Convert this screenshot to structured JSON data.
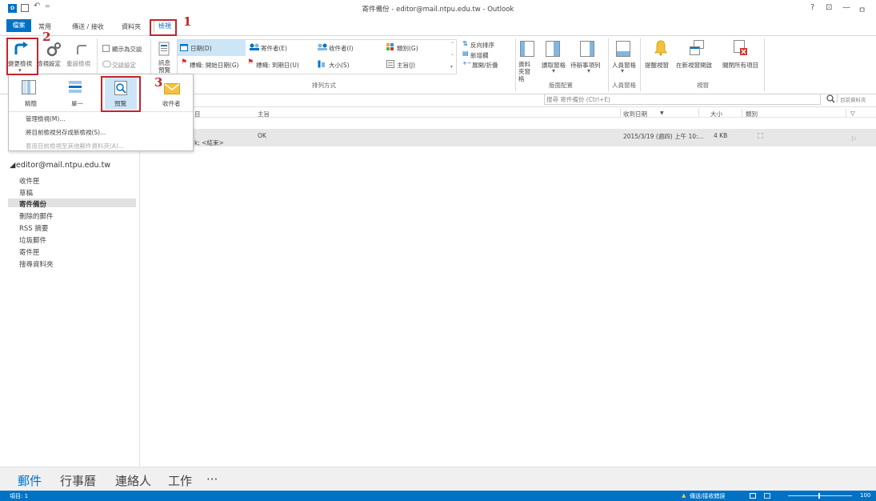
{
  "window": {
    "title": "寄件備份 - editor@mail.ntpu.edu.tw - Outlook",
    "help": "?",
    "restore_ribbon": "⊡",
    "minimize": "—",
    "maximize": "ㅁ"
  },
  "quick_access": {
    "logo": "O",
    "undo": "↶",
    "more": "="
  },
  "tabs": {
    "file": "檔案",
    "home": "常用",
    "send_receive": "傳送 / 接收",
    "folder": "資料夾",
    "view": "檢視"
  },
  "ribbon": {
    "current_view": {
      "change_view": "變更檢視",
      "view_settings": "檢視設定",
      "reset_view": "重設檢視"
    },
    "messages": {
      "show_as_conversations": "顯示為交談",
      "conversation_settings": "交談設定",
      "message_preview": "訊息預覽"
    },
    "arrangement": {
      "label": "排列方式",
      "date": "日期(D)",
      "from": "寄件者(E)",
      "to": "收件者(I)",
      "categories": "類別(G)",
      "flag_start": "標幟: 開始日期(G)",
      "flag_due": "標幟: 到期日(U)",
      "size": "大小(S)",
      "subject": "主旨(J)",
      "reverse_sort": "反向排序",
      "add_columns": "新增欄",
      "expand_collapse": "展開/折疊"
    },
    "layout": {
      "label": "版面配置",
      "folder_pane": "資料夾窗格",
      "reading_pane": "讀取窗格",
      "todo_bar": "待辦事項列"
    },
    "people_pane": {
      "label": "人員窗格",
      "people_pane": "人員窗格"
    },
    "window": {
      "label": "視窗",
      "reminders": "提醒視窗",
      "open_new_window": "在新視窗開啟",
      "close_all_items": "關閉所有項目"
    }
  },
  "dropdown": {
    "compact": "精簡",
    "single": "單一",
    "preview": "預覽",
    "sender": "收件者",
    "manage_views": "管理檢視(M)...",
    "save_as_new": "將目前檢視另存成新檢視(S)...",
    "apply_to_folders": "套用目前檢視至其他郵件資料夾(A)..."
  },
  "annotations": {
    "one": "1",
    "two": "2",
    "three": "3"
  },
  "search": {
    "placeholder": "搜尋 寄件備份 (Ctrl+E)",
    "scope": "目前資料夾"
  },
  "columns": {
    "partial_left": "目",
    "subject": "主旨",
    "received": "收到日期",
    "sort_arrow": "▼",
    "size": "大小",
    "category": "類別",
    "flag": "▽"
  },
  "messages": [
    {
      "to_partial": "k; <結束>",
      "subject": "OK",
      "received": "2015/3/19 (週四) 上午 10:...",
      "size": "4 KB"
    }
  ],
  "folder_pane": {
    "account": "editor@mail.ntpu.edu.tw",
    "folders": [
      "收件匣",
      "草稿",
      "寄件備份",
      "刪除的郵件",
      "RSS 摘要",
      "垃圾郵件",
      "寄件匣",
      "搜尋資料夾"
    ],
    "selected_index": 2
  },
  "bottom_nav": {
    "mail": "郵件",
    "calendar": "行事曆",
    "people": "連絡人",
    "tasks": "工作",
    "more": "···"
  },
  "status": {
    "items": "項目: 1",
    "warning": "傳送/接收錯誤",
    "zoom": "100"
  },
  "colors": {
    "accent": "#0072c6",
    "annotation": "#c0262d"
  }
}
